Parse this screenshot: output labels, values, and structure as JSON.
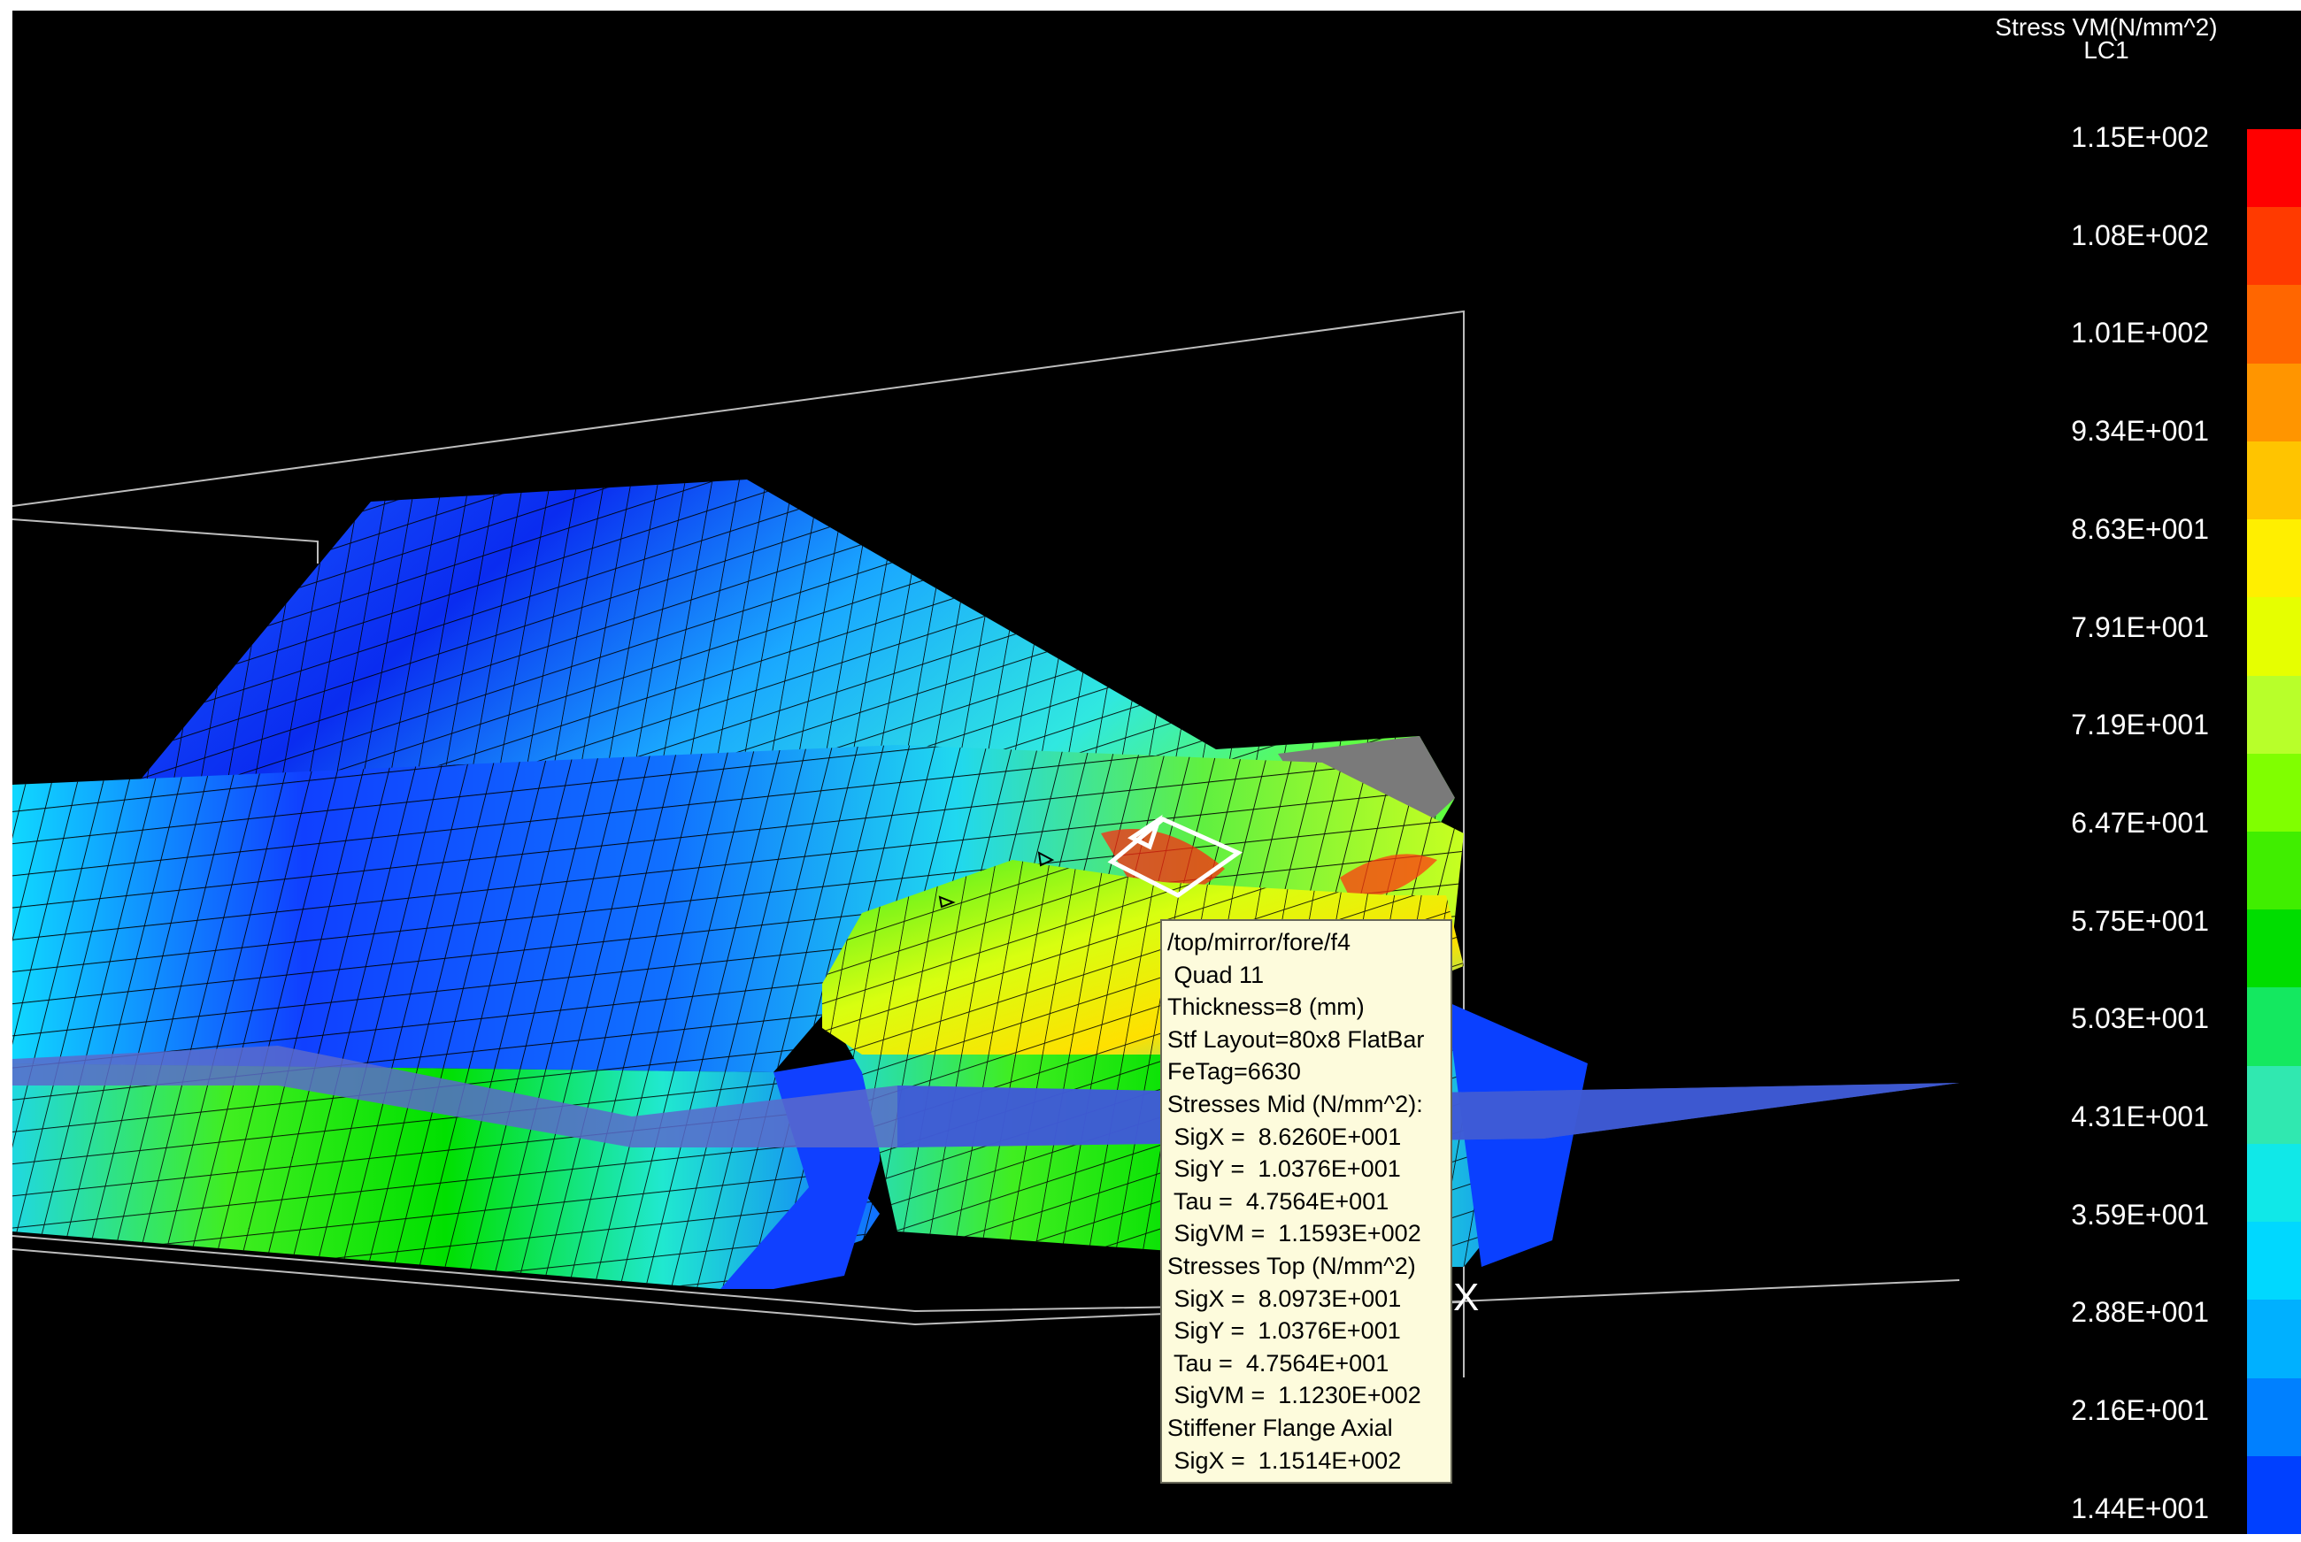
{
  "legend": {
    "title": "Stress VM(N/mm^2)",
    "subtitle": "LC1",
    "colors": [
      "#ff0000",
      "#ff3a00",
      "#ff6600",
      "#ff9500",
      "#ffc400",
      "#ffef00",
      "#e6ff00",
      "#b8ff2a",
      "#80ff00",
      "#40ee00",
      "#00dd00",
      "#14e860",
      "#30e8b0",
      "#10e8e8",
      "#00d8ff",
      "#00b0ff",
      "#0080ff",
      "#0040ff"
    ],
    "labels": [
      "1.15E+002",
      "1.08E+002",
      "1.01E+002",
      "9.34E+001",
      "8.63E+001",
      "7.91E+001",
      "7.19E+001",
      "6.47E+001",
      "5.75E+001",
      "5.03E+001",
      "4.31E+001",
      "3.59E+001",
      "2.88E+001",
      "2.16E+001",
      "1.44E+001"
    ]
  },
  "info": {
    "lines": [
      "/top/mirror/fore/f4",
      " Quad 11",
      "Thickness=8 (mm)",
      "Stf Layout=80x8 FlatBar",
      "FeTag=6630",
      "Stresses Mid (N/mm^2):",
      " SigX =  8.6260E+001",
      " SigY =  1.0376E+001",
      " Tau =  4.7564E+001",
      " SigVM =  1.1593E+002",
      "Stresses Top (N/mm^2)",
      " SigX =  8.0973E+001",
      " SigY =  1.0376E+001",
      " Tau =  4.7564E+001",
      " SigVM =  1.1230E+002",
      "Stiffener Flange Axial",
      " SigX =  1.1514E+002"
    ]
  },
  "axis": {
    "x_label": "X"
  }
}
